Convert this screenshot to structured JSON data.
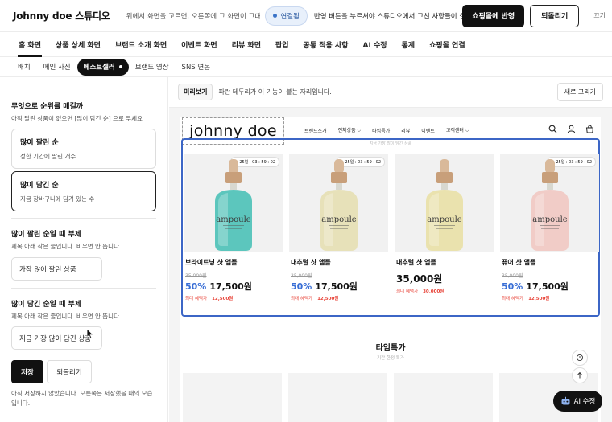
{
  "header": {
    "title": "Johnny doe 스튜디오",
    "description": "위에서 화면을 고르면, 오른쪽에 그 화면이 그대로 보입니다",
    "connected_label": "연결됨",
    "note": "반영 버튼을 누르셔야 스튜디오에서 고친 사항들이 실제로 적용됩니다",
    "apply_label": "쇼핑몰에 반영",
    "revert_label": "되돌리기",
    "close_label": "끄기"
  },
  "nav": {
    "tabs": [
      "홈 화면",
      "상품 상세 화면",
      "브랜드 소개 화면",
      "이벤트 화면",
      "리뷰 화면",
      "팝업",
      "공통 적용 사항",
      "AI 수정",
      "통계",
      "쇼핑몰 연결"
    ],
    "active_tab": "홈 화면",
    "subtabs": [
      "배치",
      "메인 사진",
      "베스트셀러",
      "브랜드 영상",
      "SNS 연동"
    ],
    "active_subtab": "베스트셀러"
  },
  "panel": {
    "ranking_title": "무엇으로 순위를 매길까",
    "ranking_sub": "아직 팔린 상품이 없으면 [많이 담긴 순] 으로 두세요",
    "options": [
      {
        "title": "많이 팔린 순",
        "sub": "정한 기간에 팔린 개수",
        "selected": false
      },
      {
        "title": "많이 담긴 순",
        "sub": "지금 장바구니에 담겨 있는 수",
        "selected": true
      }
    ],
    "sold_title": "많이 팔린 순일 때 부제",
    "sold_sub": "제목 아래 작은 줄입니다. 비우면 안 뜹니다",
    "sold_value": "가장 많이 팔린 상품",
    "cart_title": "많이 담긴 순일 때 부제",
    "cart_sub": "제목 아래 작은 줄입니다. 비우면 안 뜹니다",
    "cart_value": "지금 가장 많이 담긴 상품",
    "save_label": "저장",
    "revert_label": "되돌리기",
    "status": "아직 저장하지 않았습니다. 오른쪽은 저장했을 때의 모습입니다."
  },
  "preview": {
    "label": "미리보기",
    "hint": "파란 테두리가 이 기능이 붙는 자리입니다.",
    "refresh_label": "새로 그리기",
    "site": {
      "logo": "johnny doe",
      "menu": [
        "브랜드소개",
        "전체상품 ⌵",
        "타임특가",
        "리뷰",
        "이벤트",
        "고객센터 ⌵"
      ],
      "faint_subtitle": "지금 가장 많이 담긴 상품",
      "bottle_label": "ampoule",
      "products": [
        {
          "name": "브라이트닝 샷 앰플",
          "original": "35,000원",
          "discount": "50%",
          "price": "17,500원",
          "benefit_label": "최대 혜택가",
          "benefit": "12,500원",
          "timer": "25일 : 03 : 59 : 02",
          "color": "#4fc2b9"
        },
        {
          "name": "내추럴 샷 앰플",
          "original": "35,000원",
          "discount": "50%",
          "price": "17,500원",
          "benefit_label": "최대 혜택가",
          "benefit": "12,500원",
          "timer": "25일 : 03 : 59 : 02",
          "color": "#e6e0b4"
        },
        {
          "name": "내추럴 샷 앰플",
          "original": "",
          "discount": "",
          "price": "35,000원",
          "benefit_label": "최대 혜택가",
          "benefit": "30,000원",
          "timer": "",
          "color": "#e9e1a8"
        },
        {
          "name": "퓨어 샷 앰플",
          "original": "35,000원",
          "discount": "50%",
          "price": "17,500원",
          "benefit_label": "최대 혜택가",
          "benefit": "12,500원",
          "timer": "25일 : 03 : 59 : 02",
          "color": "#f1c9c3"
        }
      ],
      "timesale_title": "타임특가",
      "timesale_sub": "기간 한정 특가"
    },
    "ai_label": "AI 수정"
  },
  "colors": {
    "accent_blue": "#3c66c6",
    "discount_blue": "#3a6fd6",
    "benefit_red": "#e8453a"
  }
}
